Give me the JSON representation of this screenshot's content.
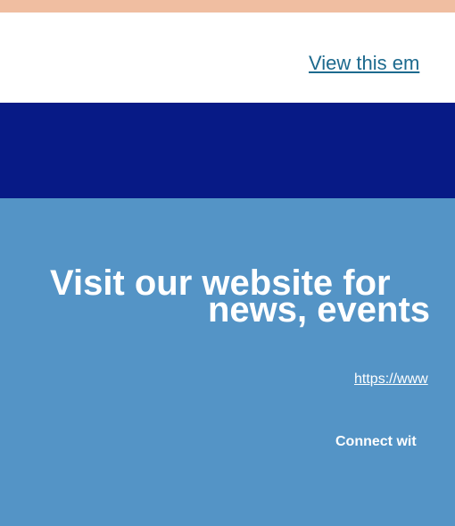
{
  "header": {
    "view_link_text": "View this em"
  },
  "promo": {
    "headline_line1": "Visit our website for",
    "headline_line2": "news, events",
    "url_text": "https://www",
    "connect_text": "Connect wit"
  },
  "colors": {
    "top_band": "#f0bea1",
    "navy_band": "#071a86",
    "promo_background": "#5494c6",
    "link_color": "#1d6a8e",
    "text_white": "#ffffff"
  }
}
